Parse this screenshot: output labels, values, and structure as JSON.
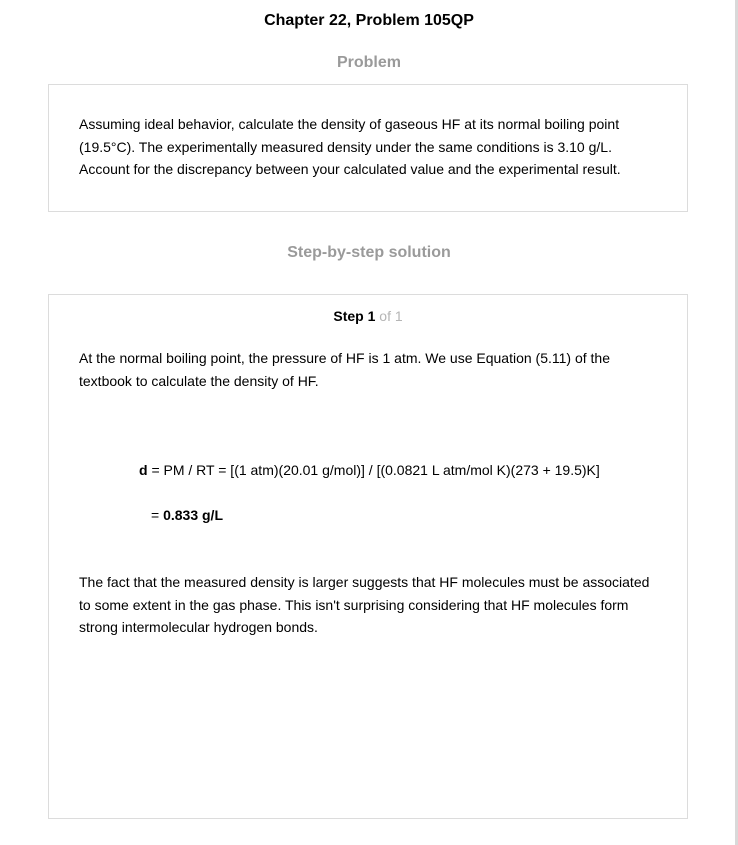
{
  "header": {
    "title": "Chapter 22, Problem 105QP"
  },
  "problem": {
    "heading": "Problem",
    "lines": [
      "Assuming ideal behavior, calculate the density of gaseous HF at its normal boiling point",
      "(19.5°C). The experimentally measured density under the same conditions is 3.10 g/L.",
      "Account for the discrepancy between your calculated value and the experimental result."
    ]
  },
  "solution": {
    "heading": "Step-by-step solution",
    "step": {
      "label": "Step",
      "number": "1",
      "of_text": "of 1"
    },
    "intro_lines": [
      "At the normal boiling point, the pressure of HF is 1 atm.  We use Equation (5.11) of the",
      "textbook to calculate the density of HF."
    ],
    "equation": {
      "variable": "d",
      "expression": " = PM / RT = [(1 atm)(20.01 g/mol)] / [(0.0821 L atm/mol K)(273 + 19.5)K]",
      "result_prefix": "= ",
      "result_value": "0.833 g/L"
    },
    "conclusion_lines": [
      "The fact that the measured density is larger suggests that HF molecules must be associated",
      "to some extent in the gas phase.  This isn't surprising considering that HF molecules form",
      "strong intermolecular hydrogen bonds."
    ]
  }
}
